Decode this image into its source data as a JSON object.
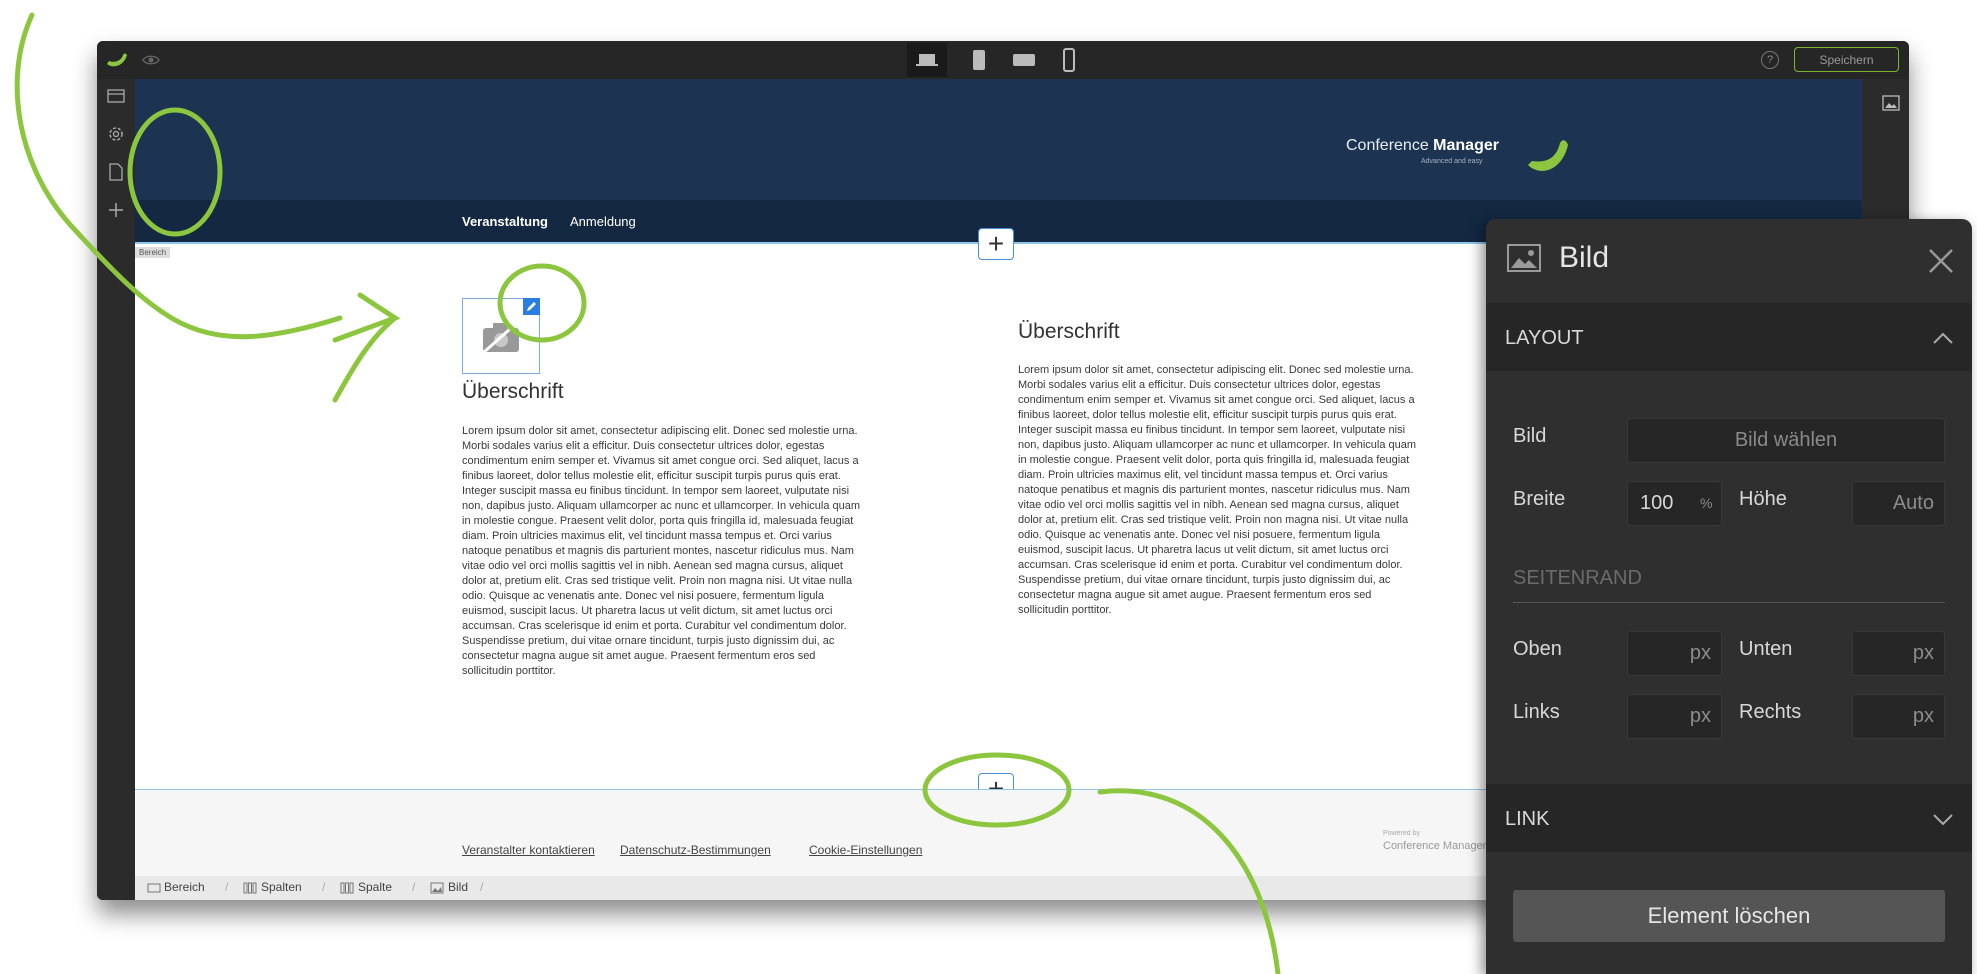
{
  "toolbar": {
    "save_label": "Speichern",
    "help_label": "?"
  },
  "site": {
    "logo_regular": "Conference ",
    "logo_bold": "Manager",
    "logo_tagline": "Advanced and easy",
    "nav": [
      "Veranstaltung",
      "Anmeldung"
    ],
    "section_tag": "Bereich",
    "col1": {
      "heading": "Überschrift",
      "text": "Lorem ipsum dolor sit amet, consectetur adipiscing elit. Donec sed molestie urna. Morbi sodales varius elit a efficitur. Duis consectetur ultrices dolor, egestas condimentum enim semper et. Vivamus sit amet congue orci. Sed aliquet, lacus a finibus laoreet, dolor tellus molestie elit, efficitur suscipit turpis purus quis erat. Integer suscipit massa eu finibus tincidunt. In tempor sem laoreet, vulputate nisi non, dapibus justo. Aliquam ullamcorper ac nunc et ullamcorper. In vehicula quam in molestie congue. Praesent velit dolor, porta quis fringilla id, malesuada feugiat diam. Proin ultricies maximus elit, vel tincidunt massa tempus et. Orci varius natoque penatibus et magnis dis parturient montes, nascetur ridiculus mus. Nam vitae odio vel orci mollis sagittis vel in nibh. Aenean sed magna cursus, aliquet dolor at, pretium elit. Cras sed tristique velit. Proin non magna nisi. Ut vitae nulla odio. Quisque ac venenatis ante. Donec vel nisi posuere, fermentum ligula euismod, suscipit lacus. Ut pharetra lacus ut velit dictum, sit amet luctus orci accumsan. Cras scelerisque id enim et porta. Curabitur vel condimentum dolor. Suspendisse pretium, dui vitae ornare tincidunt, turpis justo dignissim dui, ac consectetur magna augue sit amet augue. Praesent fermentum eros sed sollicitudin porttitor."
    },
    "col2": {
      "heading": "Überschrift",
      "text": "Lorem ipsum dolor sit amet, consectetur adipiscing elit. Donec sed molestie urna. Morbi sodales varius elit a efficitur. Duis consectetur ultrices dolor, egestas condimentum enim semper et. Vivamus sit amet congue orci. Sed aliquet, lacus a finibus laoreet, dolor tellus molestie elit, efficitur suscipit turpis purus quis erat. Integer suscipit massa eu finibus tincidunt. In tempor sem laoreet, vulputate nisi non, dapibus justo. Aliquam ullamcorper ac nunc et ullamcorper. In vehicula quam in molestie congue. Praesent velit dolor, porta quis fringilla id, malesuada feugiat diam. Proin ultricies maximus elit, vel tincidunt massa tempus et. Orci varius natoque penatibus et magnis dis parturient montes, nascetur ridiculus mus. Nam vitae odio vel orci mollis sagittis vel in nibh. Aenean sed magna cursus, aliquet dolor at, pretium elit. Cras sed tristique velit. Proin non magna nisi. Ut vitae nulla odio. Quisque ac venenatis ante. Donec vel nisi posuere, fermentum ligula euismod, suscipit lacus. Ut pharetra lacus ut velit dictum, sit amet luctus orci accumsan. Cras scelerisque id enim et porta. Curabitur vel condimentum dolor. Suspendisse pretium, dui vitae ornare tincidunt, turpis justo dignissim dui, ac consectetur magna augue sit amet augue. Praesent fermentum eros sed sollicitudin porttitor."
    },
    "footer_links": [
      "Veranstalter kontaktieren",
      "Datenschutz-Bestimmungen",
      "Cookie-Einstellungen"
    ],
    "footer_powered": "Powered by",
    "footer_brand": "Conference Manager"
  },
  "breadcrumb": [
    "Bereich",
    "Spalten",
    "Spalte",
    "Bild"
  ],
  "panel": {
    "title": "Bild",
    "layout_title": "LAYOUT",
    "bild_label": "Bild",
    "bild_button": "Bild wählen",
    "breite_label": "Breite",
    "breite_value": "100",
    "breite_unit": "%",
    "hoehe_label": "Höhe",
    "hoehe_value": "Auto",
    "seitenrand_title": "SEITENRAND",
    "oben_label": "Oben",
    "unten_label": "Unten",
    "links_label": "Links",
    "rechts_label": "Rechts",
    "px_unit": "px",
    "link_title": "LINK",
    "delete_label": "Element löschen"
  },
  "colors": {
    "accent": "#8cc63f",
    "header_bg": "#1c3351",
    "nav_bg": "#142842",
    "panel_bg": "#2f2f2f",
    "selection_blue": "#2a7de1"
  }
}
